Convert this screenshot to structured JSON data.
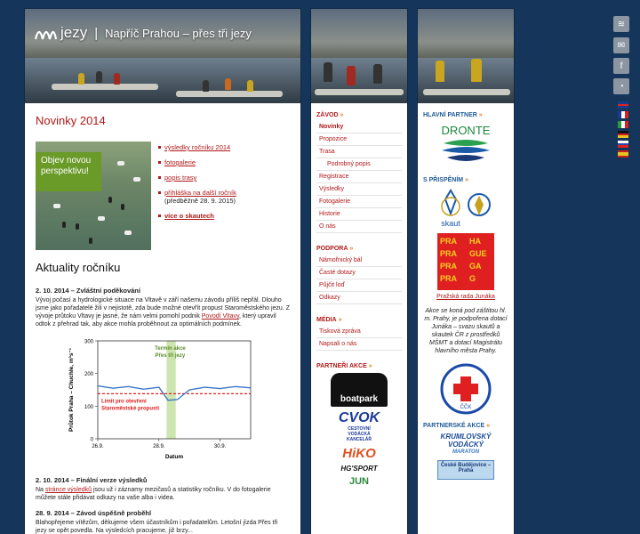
{
  "header": {
    "logo_word": "jezy",
    "separator": "|",
    "subtitle": "Napříč Prahou – přes tři jezy"
  },
  "main": {
    "heading": "Novinky 2014",
    "promo_image_text": "Objev novou perspektivu!",
    "promo_links": [
      {
        "label": "výsledky ročníku 2014",
        "note": ""
      },
      {
        "label": "fotogalerie",
        "note": ""
      },
      {
        "label": "popis trasy",
        "note": ""
      },
      {
        "label": "přihláška na další ročník",
        "note": "(předběžně 28. 9. 2015)"
      },
      {
        "label": "více o skautech",
        "note": ""
      }
    ],
    "section_heading": "Aktuality ročníku",
    "news": [
      {
        "title": "2. 10. 2014 – Zvláštní poděkování",
        "text_before": "Vývoj počasí a hydrologické situace na Vltavě v září našemu závodu příliš nepřál. Dlouho jsme jako pořadatelé žili v nejistotě, zda bude možné otevřít propust Staroměstského jezu. Z vývoje průtoku Vltavy je jasné, že nám velmi pomohl podnik ",
        "link": "Povodí Vltavy",
        "text_after": ", který upravil odtok z přehrad tak, aby akce mohla proběhnout za optimálních podmínek."
      },
      {
        "title": "2. 10. 2014 – Finální verze výsledků",
        "text_before": "Na ",
        "link": "stránce výsledků",
        "text_after": " jsou už i záznamy mezičasů a statistiky ročníku. V do fotogalerie můžete stále přidávat odkazy na vaše alba i videa."
      },
      {
        "title": "28. 9. 2014 – Závod úspěšně proběhl",
        "text_before": "Blahopřejeme vítězům, děkujeme všem účastníkům i pořadatelům. Letošní jízda Přes tři jezy se opět povedla. Na výsledcích pracujeme, již brzy...",
        "link": "",
        "text_after": ""
      }
    ]
  },
  "chart_data": {
    "type": "line",
    "xlabel": "Datum",
    "ylabel": "Průtok Praha – Chuchle, m³s⁻¹",
    "x_ticks": [
      "26.9.",
      "28.9.",
      "30.9."
    ],
    "y_ticks": [
      "0",
      "100",
      "200",
      "300"
    ],
    "ylim": [
      0,
      300
    ],
    "x": [
      0,
      0.5,
      1,
      1.5,
      2,
      2.3,
      2.6,
      3,
      3.5,
      4,
      4.5,
      5
    ],
    "values": [
      162,
      155,
      160,
      152,
      158,
      118,
      120,
      150,
      158,
      154,
      160,
      156
    ],
    "threshold": {
      "value": 138,
      "label": "Limit pro otevření Staroměstské propusti"
    },
    "event": {
      "label": "Termín akce Přes tři jezy",
      "x_from": 2.25,
      "x_to": 2.55
    },
    "colors": {
      "line": "#3c78c8",
      "threshold": "#e02020",
      "event": "#cde6b0",
      "event_text": "#5a8a28"
    }
  },
  "nav": {
    "sections": [
      {
        "title": "ZÁVOD",
        "items": [
          {
            "label": "Novinky",
            "active": true,
            "sub": false
          },
          {
            "label": "Propozice",
            "active": false,
            "sub": false
          },
          {
            "label": "Trasa",
            "active": false,
            "sub": false
          },
          {
            "label": "Podrobný popis",
            "active": false,
            "sub": true
          },
          {
            "label": "Registrace",
            "active": false,
            "sub": false
          },
          {
            "label": "Výsledky",
            "active": false,
            "sub": false
          },
          {
            "label": "Fotogalerie",
            "active": false,
            "sub": false
          },
          {
            "label": "Historie",
            "active": false,
            "sub": false
          },
          {
            "label": "O nás",
            "active": false,
            "sub": false
          }
        ]
      },
      {
        "title": "PODPORA",
        "items": [
          {
            "label": "Námořnický bál",
            "active": false,
            "sub": false
          },
          {
            "label": "Časté dotazy",
            "active": false,
            "sub": false
          },
          {
            "label": "Půjčit loď",
            "active": false,
            "sub": false
          },
          {
            "label": "Odkazy",
            "active": false,
            "sub": false
          }
        ]
      },
      {
        "title": "MÉDIA",
        "items": [
          {
            "label": "Tisková zpráva",
            "active": false,
            "sub": false
          },
          {
            "label": "Napsali o nás",
            "active": false,
            "sub": false
          }
        ]
      }
    ],
    "partners_title": "PARTNEŘI AKCE",
    "partners": [
      "boatpark",
      "CVOK",
      "CESTOVNÍ VODÁCKÁ KANCELÁŘ",
      "HiKO",
      "HG'SPORT",
      "JUN"
    ]
  },
  "right": {
    "main_partner_title": "HLAVNÍ PARTNER",
    "main_partner": "DRONTE",
    "support_title": "S PŘISPĚNÍM",
    "skaut_label": "skaut",
    "praha_words": [
      "PRA",
      "HA",
      "PRAGUE",
      "PRAGA",
      "PRAG"
    ],
    "praha_caption": "Pražská rada Junáka",
    "support_text": "Akce se koná pod záštitou hl. m. Prahy, je podpořena dotací Junáka – svazu skautů a skautek ČR z prostředků MŠMT a dotací Magistrátu hlavního města Prahy.",
    "cck_label": "ČČK",
    "cck_ring": "VODNÍ ZÁCHRANNÁ SLUŽBA",
    "partner_actions_title": "PARTNERSKÉ AKCE",
    "krumlov": [
      "KRUMLOVSKÝ",
      "VODÁCKÝ",
      "MARATON"
    ],
    "budejovice": "České Budějovice – Praha"
  },
  "social": {
    "icons": [
      "jezy-icon",
      "mail-icon",
      "facebook-icon",
      "rss-icon"
    ]
  },
  "flags": {
    "languages": [
      "en",
      "fr",
      "it",
      "de",
      "ru",
      "es"
    ]
  }
}
